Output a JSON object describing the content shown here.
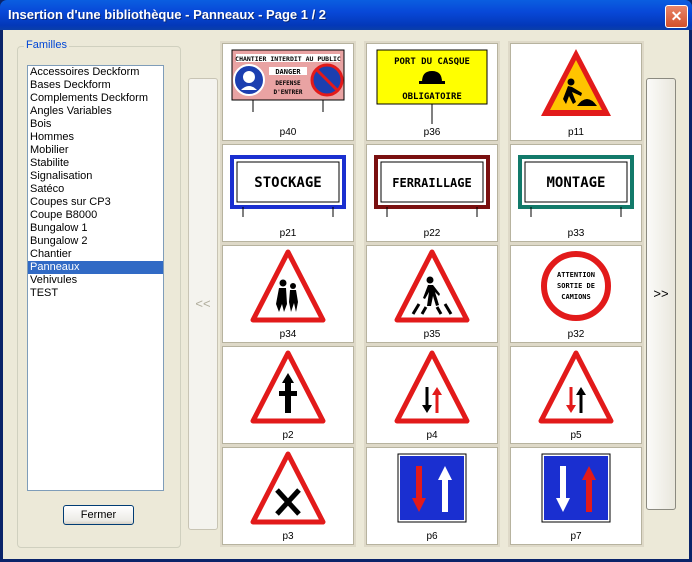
{
  "window": {
    "title": "Insertion d'une bibliothèque - Panneaux - Page 1 / 2",
    "close_label": "✕"
  },
  "families": {
    "legend": "Familles",
    "items": [
      {
        "label": "Accessoires Deckform",
        "selected": false
      },
      {
        "label": "Bases Deckform",
        "selected": false
      },
      {
        "label": "Complements Deckform",
        "selected": false
      },
      {
        "label": "Angles Variables",
        "selected": false
      },
      {
        "label": "Bois",
        "selected": false
      },
      {
        "label": "Hommes",
        "selected": false
      },
      {
        "label": "Mobilier",
        "selected": false
      },
      {
        "label": "Stabilite",
        "selected": false
      },
      {
        "label": "Signalisation",
        "selected": false
      },
      {
        "label": "Satéco",
        "selected": false
      },
      {
        "label": "Coupes sur CP3",
        "selected": false
      },
      {
        "label": "Coupe B8000",
        "selected": false
      },
      {
        "label": "Bungalow 1",
        "selected": false
      },
      {
        "label": "Bungalow 2",
        "selected": false
      },
      {
        "label": "Chantier",
        "selected": false
      },
      {
        "label": "Panneaux",
        "selected": true
      },
      {
        "label": "Vehivules",
        "selected": false
      },
      {
        "label": "TEST",
        "selected": false
      }
    ],
    "close_button": "Fermer"
  },
  "nav": {
    "prev": "<<",
    "next": ">>"
  },
  "tiles": [
    {
      "label": "p40",
      "sign_texts": [
        "CHANTIER INTERDIT AU PUBLIC",
        "DANGER",
        "DEFENSE",
        "D'ENTRER"
      ]
    },
    {
      "label": "p36",
      "sign_texts": [
        "PORT DU CASQUE",
        "OBLIGATOIRE"
      ]
    },
    {
      "label": "p11",
      "sign_texts": []
    },
    {
      "label": "p21",
      "sign_texts": [
        "STOCKAGE"
      ]
    },
    {
      "label": "p22",
      "sign_texts": [
        "FERRAILLAGE"
      ]
    },
    {
      "label": "p33",
      "sign_texts": [
        "MONTAGE"
      ]
    },
    {
      "label": "p34",
      "sign_texts": []
    },
    {
      "label": "p35",
      "sign_texts": []
    },
    {
      "label": "p32",
      "sign_texts": [
        "ATTENTION",
        "SORTIE DE",
        "CAMIONS"
      ]
    },
    {
      "label": "p2",
      "sign_texts": []
    },
    {
      "label": "p4",
      "sign_texts": []
    },
    {
      "label": "p5",
      "sign_texts": []
    },
    {
      "label": "p3",
      "sign_texts": []
    },
    {
      "label": "p6",
      "sign_texts": []
    },
    {
      "label": "p7",
      "sign_texts": []
    }
  ]
}
